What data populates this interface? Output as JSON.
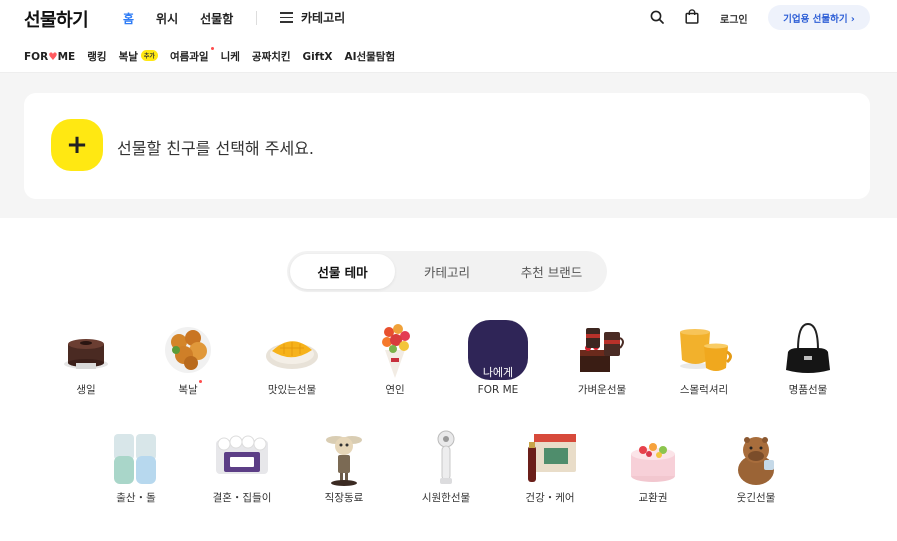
{
  "header": {
    "logo": "선물하기",
    "nav": [
      {
        "label": "홈",
        "active": true
      },
      {
        "label": "위시",
        "active": false
      },
      {
        "label": "선물함",
        "active": false
      }
    ],
    "category_label": "카테고리",
    "login_label": "로그인",
    "biz_button_label": "기업용 선물하기 ›"
  },
  "subnav": {
    "for_me": {
      "prefix": "FOR",
      "heart": "♥",
      "suffix": "ME"
    },
    "ranking": "랭킹",
    "boknal": "복날",
    "boknal_badge": "추가",
    "summer_fruit": "여름과일",
    "nike": "니케",
    "chicken": "공짜치킨",
    "giftx": "GiftX",
    "ai": "AI선물탐험"
  },
  "friend": {
    "plus": "+",
    "prompt": "선물할 친구를 선택해 주세요."
  },
  "tabs": [
    "선물 테마",
    "카테고리",
    "추천 브랜드"
  ],
  "themes_row1": [
    "생일",
    "복날",
    "맛있는선물",
    "연인",
    "FOR ME",
    "가벼운선물",
    "스몰럭셔리",
    "명품선물"
  ],
  "themes_row2": [
    "출산・돌",
    "결혼・집들이",
    "직장동료",
    "시원한선물",
    "건강・케어",
    "교환권",
    "웃긴선물"
  ],
  "for_me_tile_text": "나에게",
  "colors": {
    "accent_blue": "#2e7cf6",
    "kakao_yellow": "#ffe812",
    "biz_button_bg": "#eef2fb",
    "new_dot": "#ff4d4d"
  }
}
